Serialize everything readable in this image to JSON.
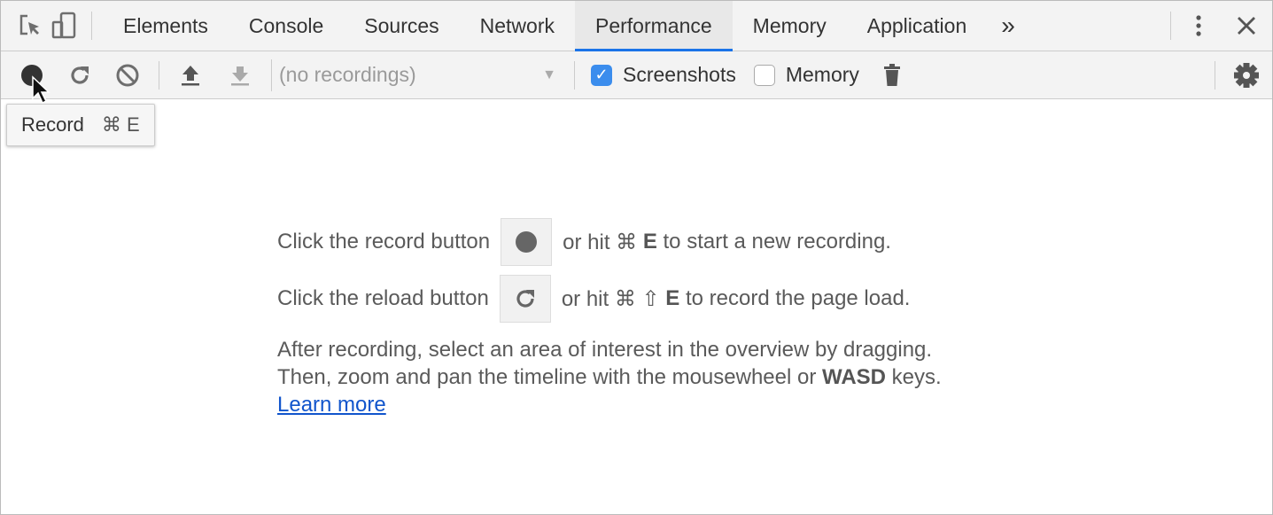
{
  "tabbar": {
    "tabs": [
      {
        "label": "Elements"
      },
      {
        "label": "Console"
      },
      {
        "label": "Sources"
      },
      {
        "label": "Network"
      },
      {
        "label": "Performance",
        "active": true
      },
      {
        "label": "Memory"
      },
      {
        "label": "Application"
      }
    ],
    "more": "»"
  },
  "toolbar": {
    "recordings_select": "(no recordings)",
    "screenshots_label": "Screenshots",
    "screenshots_checked": true,
    "memory_label": "Memory",
    "memory_checked": false
  },
  "tooltip": {
    "label": "Record",
    "shortcut": "⌘ E"
  },
  "main": {
    "line1_a": "Click the record button",
    "line1_b": "or hit ⌘ ",
    "line1_key": "E",
    "line1_c": " to start a new recording.",
    "line2_a": "Click the reload button",
    "line2_b": "or hit ⌘ ⇧ ",
    "line2_key": "E",
    "line2_c": " to record the page load.",
    "para1": "After recording, select an area of interest in the overview by dragging.",
    "para2_a": "Then, zoom and pan the timeline with the mousewheel or ",
    "para2_key": "WASD",
    "para2_b": " keys.",
    "learn_more": "Learn more"
  },
  "colors": {
    "accent": "#1a73e8",
    "checkbox": "#3b8ded",
    "link": "#1155cc"
  }
}
